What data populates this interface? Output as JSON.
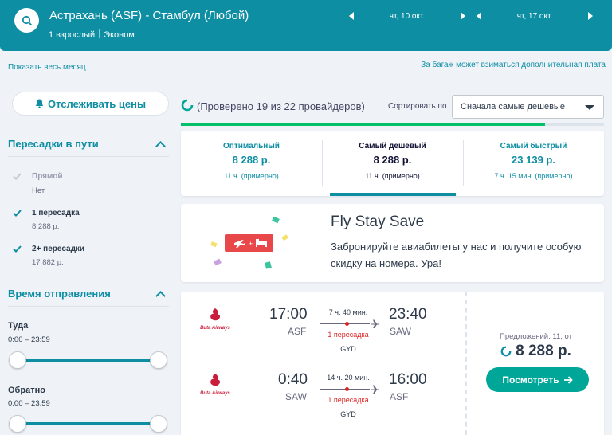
{
  "header": {
    "route": "Астрахань (ASF) - Стамбул (Любой)",
    "passengers": "1 взрослый",
    "cabin": "Эконом",
    "depart_date": "чт, 10 окт.",
    "return_date": "чт, 17 окт."
  },
  "links": {
    "show_month": "Показать весь месяц",
    "baggage_note": "За багаж может взиматься дополнительная плата"
  },
  "sidebar": {
    "track_label": "Отслеживать цены",
    "stops": {
      "title": "Пересадки в пути",
      "options": [
        {
          "label": "Прямой",
          "price": "Нет",
          "checked": false
        },
        {
          "label": "1 пересадка",
          "price": "8 288 р.",
          "checked": true
        },
        {
          "label": "2+ пересадки",
          "price": "17 882 р.",
          "checked": true
        }
      ]
    },
    "times": {
      "title": "Время отправления",
      "outbound_label": "Туда",
      "outbound_range": "0:00 – 23:59",
      "return_label": "Обратно",
      "return_range": "0:00 – 23:59"
    }
  },
  "progress": {
    "text": "(Проверено 19 из 22 провайдеров)",
    "fraction": 0.86
  },
  "sort": {
    "label": "Сортировать по",
    "value": "Сначала самые дешевые"
  },
  "tabs": [
    {
      "title": "Оптимальный",
      "price": "8 288 р.",
      "duration": "11 ч. (примерно)"
    },
    {
      "title": "Самый дешевый",
      "price": "8 288 р.",
      "duration": "11 ч. (примерно)"
    },
    {
      "title": "Самый быстрый",
      "price": "23 139 р.",
      "duration": "7 ч. 15 мин. (примерно)"
    }
  ],
  "promo": {
    "title": "Fly Stay Save",
    "text1": "Забронируйте авиабилеты у нас и получите особую",
    "text2": "скидку на номера. Ура!"
  },
  "result": {
    "airline": "Buta Airways",
    "legs": [
      {
        "dep_time": "17:00",
        "dep_iata": "ASF",
        "duration": "7 ч. 40 мин.",
        "stops": "1 пересадка",
        "via": "GYD",
        "arr_time": "23:40",
        "arr_iata": "SAW"
      },
      {
        "dep_time": "0:40",
        "dep_iata": "SAW",
        "duration": "14 ч. 20 мин.",
        "stops": "1 пересадка",
        "via": "GYD",
        "arr_time": "16:00",
        "arr_iata": "ASF"
      }
    ],
    "offers": "Предложений: 11, от",
    "price": "8 288 р.",
    "button": "Посмотреть"
  },
  "colors": {
    "brand": "#0e8ea3",
    "accent_green": "#00a698",
    "stop_red": "#e02020"
  }
}
